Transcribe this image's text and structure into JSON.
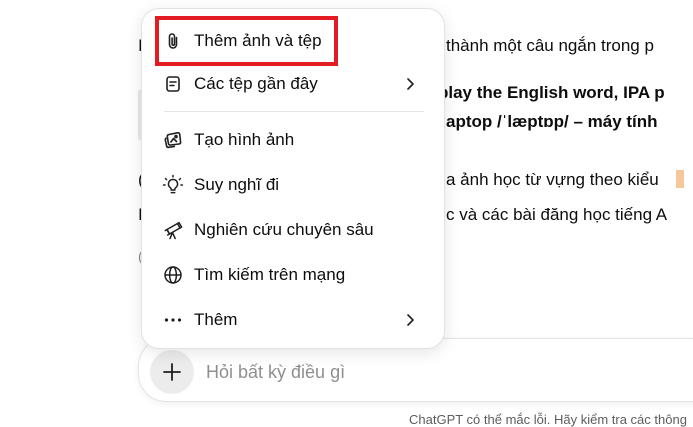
{
  "background": {
    "line1": "thành một câu ngắn trong p",
    "line2": "play the English word, IPA p",
    "line3": "aptop /ˈlæptɒp/ – máy tính",
    "line4": "a ảnh học từ vựng theo kiểu",
    "line5": "c và các bài đăng học tiếng A",
    "frag1": "I",
    "frag2": "(",
    "frag3": "I",
    "frag4": "("
  },
  "menu": {
    "items": [
      {
        "label": "Thêm ảnh và tệp",
        "icon": "paperclip-icon"
      },
      {
        "label": "Các tệp gần đây",
        "icon": "file-icon"
      },
      {
        "label": "Tạo hình ảnh",
        "icon": "image-create-icon"
      },
      {
        "label": "Suy nghĩ đi",
        "icon": "lightbulb-icon"
      },
      {
        "label": "Nghiên cứu chuyên sâu",
        "icon": "telescope-icon"
      },
      {
        "label": "Tìm kiếm trên mạng",
        "icon": "globe-icon"
      },
      {
        "label": "Thêm",
        "icon": "more-dots-icon"
      }
    ]
  },
  "composer": {
    "placeholder": "Hỏi bất kỳ điều gì"
  },
  "footer": {
    "note": "ChatGPT có thể mắc lỗi. Hãy kiểm tra các thông"
  },
  "colors": {
    "highlight": "#e31b23",
    "menu_border": "#e2e2e2"
  }
}
